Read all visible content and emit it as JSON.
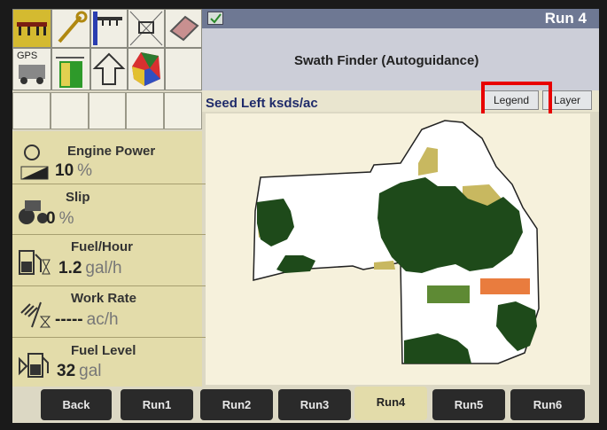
{
  "window": {
    "run_title": "Run 4"
  },
  "header": {
    "title": "Swath Finder (Autoguidance)"
  },
  "toolbar": {
    "gps_label": "GPS",
    "icons": [
      "implement-icon",
      "wrench-icon",
      "sprayer-icon",
      "tractor-icon",
      "book-icon",
      "gps-icon",
      "guidance-icon",
      "up-arrow-icon",
      "field-map-icon"
    ]
  },
  "layer": {
    "title": "Seed Left ksds/ac",
    "legend_label": "Legend",
    "layer_label": "Layer"
  },
  "stats": [
    {
      "label": "Engine Power",
      "value": "10",
      "unit": "%",
      "icon": "engine-power-icon"
    },
    {
      "label": "Slip",
      "value": "0",
      "unit": "%",
      "icon": "slip-icon"
    },
    {
      "label": "Fuel/Hour",
      "value": "1.2",
      "unit": "gal/h",
      "icon": "fuel-hour-icon"
    },
    {
      "label": "Work Rate",
      "value": "-----",
      "unit": "ac/h",
      "icon": "work-rate-icon"
    },
    {
      "label": "Fuel Level",
      "value": "32",
      "unit": "gal",
      "icon": "fuel-level-icon"
    }
  ],
  "tabs": [
    {
      "label": "Back",
      "active": false
    },
    {
      "label": "Run1",
      "active": false
    },
    {
      "label": "Run2",
      "active": false
    },
    {
      "label": "Run3",
      "active": false
    },
    {
      "label": "Run4",
      "active": true
    },
    {
      "label": "Run5",
      "active": false
    },
    {
      "label": "Run6",
      "active": false
    }
  ],
  "colors": {
    "dark_green": "#1e4a1a",
    "olive": "#c8b860",
    "medium_green": "#5e8a34",
    "orange": "#e97c3e",
    "highlight_red": "#e80000"
  }
}
